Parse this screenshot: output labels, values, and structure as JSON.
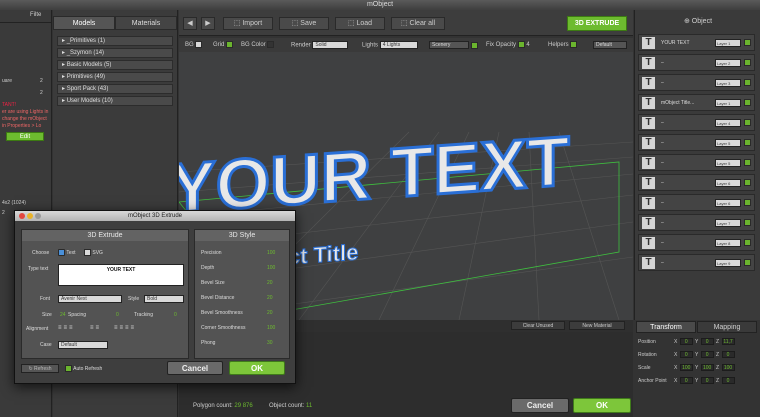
{
  "window": {
    "title": "mObject"
  },
  "left_strip": {
    "tab": "Filte",
    "text_lines": [
      "er are using Lights in",
      "change the mObject",
      "in Properties > Lo"
    ],
    "edit": "Edit",
    "numbers": [
      "2",
      "2",
      "4x2 (1024)",
      "2",
      "2"
    ],
    "label_square": "uare",
    "label_start": "TANT!"
  },
  "library": {
    "tabs": [
      "Models",
      "Materials"
    ],
    "items": [
      "_Primitives (1)",
      "_Szymon (14)",
      "Basic Models (5)",
      "Primitives (49)",
      "Sport Pack (43)",
      "User Models (10)"
    ]
  },
  "toolbar": {
    "import": "Import",
    "save": "Save",
    "load": "Load",
    "clear": "Clear all",
    "extrude": "3D EXTRUDE"
  },
  "options": {
    "bg": "BG",
    "grid": "Grid",
    "bgcolor": "BG Color",
    "render": "Render",
    "render_value": "Solid",
    "lights": "Lights",
    "lights_value": "4 Lights",
    "scenery": "Scenery",
    "fixopacity": "Fix Opacity",
    "fixopacity_value": "4",
    "helpers": "Helpers",
    "default": "Default"
  },
  "viewport": {
    "main_text": "YOUR TEXT",
    "sub_text": "Object Title"
  },
  "viewport_footer": {
    "clear_unused": "Clear Unused",
    "new_material": "New Material"
  },
  "status": {
    "polygon_label": "Polygon count:",
    "polygon_value": "29 876",
    "object_label": "Object count:",
    "object_value": "11",
    "cancel": "Cancel",
    "ok": "OK"
  },
  "objects": {
    "header": "Object",
    "rows": [
      {
        "name": "YOUR TEXT",
        "layer": "Layer 1"
      },
      {
        "name": "–",
        "layer": "Layer 2"
      },
      {
        "name": "–",
        "layer": "Layer 3"
      },
      {
        "name": "mObject Title...",
        "layer": "Layer 1"
      },
      {
        "name": "–",
        "layer": "Layer 4"
      },
      {
        "name": "–",
        "layer": "Layer 5"
      },
      {
        "name": "–",
        "layer": "Layer 5"
      },
      {
        "name": "–",
        "layer": "Layer 6"
      },
      {
        "name": "–",
        "layer": "Layer 6"
      },
      {
        "name": "–",
        "layer": "Layer 7"
      },
      {
        "name": "–",
        "layer": "Layer 8"
      },
      {
        "name": "–",
        "layer": "Layer 9"
      }
    ]
  },
  "transform": {
    "tabs": [
      "Transform",
      "Mapping"
    ],
    "rows": [
      {
        "label": "Position",
        "x": "0",
        "y": "0",
        "z": "11,7"
      },
      {
        "label": "Rotation",
        "x": "0",
        "y": "0",
        "z": "0"
      },
      {
        "label": "Scale",
        "x": "100",
        "y": "100",
        "z": "100"
      },
      {
        "label": "Anchor Point",
        "x": "0",
        "y": "0",
        "z": "0"
      }
    ]
  },
  "dialog": {
    "title": "mObject 3D Extrude",
    "extrude_head": "3D Extrude",
    "style_head": "3D Style",
    "choose": "Choose",
    "opt_text": "Text",
    "opt_svg": "SVG",
    "type_text": "Type text",
    "text_value": "YOUR TEXT",
    "font": "Font",
    "font_value": "Avenir Next",
    "style": "Style",
    "style_value": "Bold",
    "size": "Size",
    "size_value": "24",
    "spacing": "Spacing",
    "spacing_value": "0",
    "tracking": "Tracking",
    "tracking_value": "0",
    "alignment": "Alignment",
    "case": "Case",
    "case_value": "Default",
    "refresh": "Refresh",
    "auto_refresh": "Auto Refresh",
    "cancel": "Cancel",
    "ok": "OK",
    "style_rows": [
      {
        "label": "Precision",
        "value": "100"
      },
      {
        "label": "Depth",
        "value": "100"
      },
      {
        "label": "Bevel Size",
        "value": "20"
      },
      {
        "label": "Bevel Distance",
        "value": "20"
      },
      {
        "label": "Bevel Smoothness",
        "value": "20"
      },
      {
        "label": "Corner Smoothness",
        "value": "100"
      },
      {
        "label": "Phong",
        "value": "30"
      }
    ]
  },
  "colors": {
    "accent": "#6dbb2f",
    "text_blue": "#2a6fd6"
  }
}
